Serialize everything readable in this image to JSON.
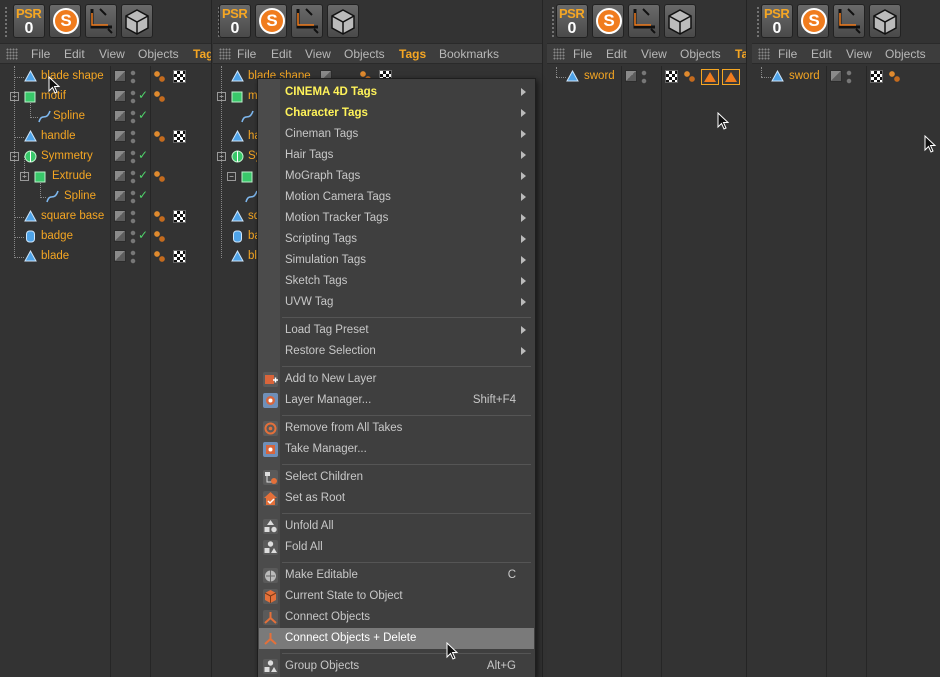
{
  "toolbar": {
    "psr_label": "PSR",
    "psr_value": "0",
    "snap_label": "S"
  },
  "panels": [
    {
      "menu": [
        "File",
        "Edit",
        "View",
        "Objects",
        "Tag"
      ],
      "active_menu": "Tag",
      "objects": [
        {
          "name": "blade shape"
        },
        {
          "name": "motif"
        },
        {
          "name": "Spline"
        },
        {
          "name": "handle"
        },
        {
          "name": "Symmetry"
        },
        {
          "name": "Extrude"
        },
        {
          "name": "Spline"
        },
        {
          "name": "square base"
        },
        {
          "name": "badge"
        },
        {
          "name": "blade"
        }
      ]
    },
    {
      "menu": [
        "File",
        "Edit",
        "View",
        "Objects",
        "Tags",
        "Bookmarks"
      ],
      "active_menu": "Tags",
      "objects": [
        {
          "name": "blade shape"
        },
        {
          "name": "m"
        },
        {
          "name": ""
        },
        {
          "name": "ha"
        },
        {
          "name": "Sy"
        },
        {
          "name": ""
        },
        {
          "name": ""
        },
        {
          "name": "sq"
        },
        {
          "name": "ba"
        },
        {
          "name": "bl"
        }
      ]
    },
    {
      "menu": [
        "File",
        "Edit",
        "View",
        "Objects",
        "Ta"
      ],
      "active_menu": "Ta",
      "objects": [
        {
          "name": "sword"
        }
      ]
    },
    {
      "menu": [
        "File",
        "Edit",
        "View",
        "Objects"
      ],
      "objects": [
        {
          "name": "sword"
        }
      ]
    }
  ],
  "context_menu": {
    "items": [
      {
        "label": "CINEMA 4D Tags",
        "submenu": true,
        "highlight": true
      },
      {
        "label": "Character Tags",
        "submenu": true,
        "highlight": true
      },
      {
        "label": "Cineman Tags",
        "submenu": true
      },
      {
        "label": "Hair Tags",
        "submenu": true
      },
      {
        "label": "MoGraph Tags",
        "submenu": true
      },
      {
        "label": "Motion Camera Tags",
        "submenu": true
      },
      {
        "label": "Motion Tracker Tags",
        "submenu": true
      },
      {
        "label": "Scripting Tags",
        "submenu": true
      },
      {
        "label": "Simulation Tags",
        "submenu": true
      },
      {
        "label": "Sketch Tags",
        "submenu": true
      },
      {
        "label": "UVW Tag",
        "submenu": true
      },
      {
        "label": "Load Tag Preset",
        "submenu": true
      },
      {
        "label": "Restore Selection",
        "submenu": true
      },
      {
        "label": "Add to New Layer",
        "icon": "add-layer-icon"
      },
      {
        "label": "Layer Manager...",
        "shortcut": "Shift+F4",
        "icon": "layer-manager-icon"
      },
      {
        "label": "Remove from All Takes",
        "icon": "remove-takes-icon"
      },
      {
        "label": "Take Manager...",
        "icon": "take-manager-icon"
      },
      {
        "label": "Select Children",
        "icon": "select-children-icon"
      },
      {
        "label": "Set as Root",
        "icon": "set-root-icon"
      },
      {
        "label": "Unfold All",
        "icon": "unfold-all-icon"
      },
      {
        "label": "Fold All",
        "icon": "fold-all-icon"
      },
      {
        "label": "Make Editable",
        "shortcut": "C",
        "icon": "make-editable-icon"
      },
      {
        "label": "Current State to Object",
        "icon": "current-state-icon"
      },
      {
        "label": "Connect Objects",
        "icon": "connect-objects-icon"
      },
      {
        "label": "Connect Objects + Delete",
        "icon": "connect-delete-icon",
        "selected": true
      },
      {
        "label": "Group Objects",
        "shortcut": "Alt+G",
        "icon": "group-objects-icon"
      }
    ]
  },
  "colors": {
    "object_name": "#f5a623",
    "highlight_menu": "#fff35a",
    "check": "#4fd36a"
  }
}
